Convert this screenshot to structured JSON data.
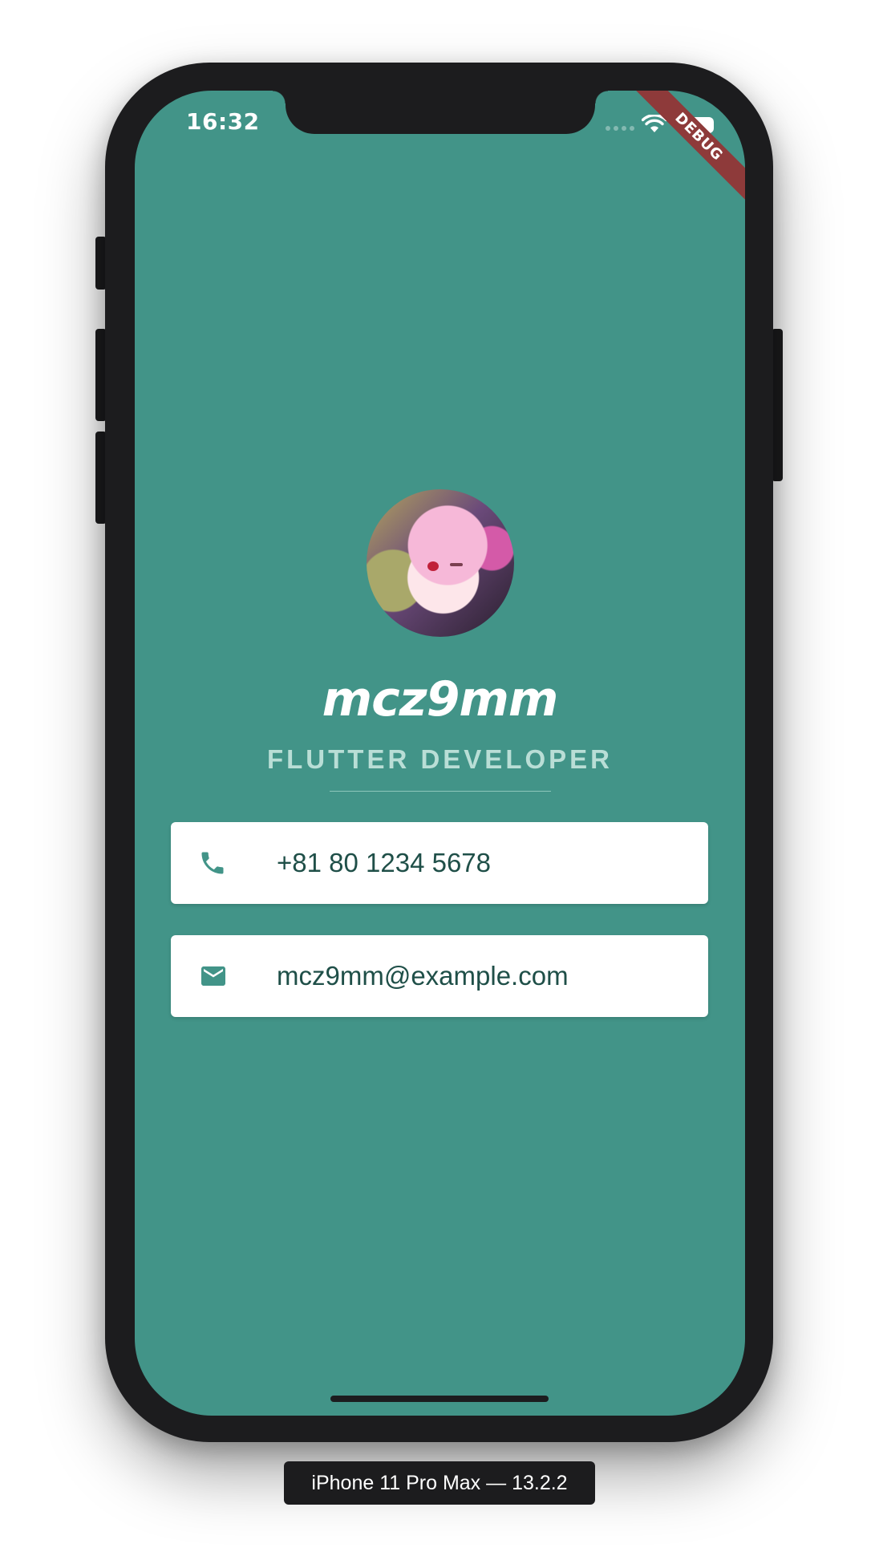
{
  "status_bar": {
    "time": "16:32",
    "debug_label": "DEBUG"
  },
  "profile": {
    "name": "mcz9mm",
    "role": "FLUTTER DEVELOPER"
  },
  "contacts": {
    "phone": "+81 80 1234 5678",
    "email": "mcz9mm@example.com"
  },
  "device_label": "iPhone 11 Pro Max — 13.2.2",
  "colors": {
    "background": "#429488",
    "card": "#ffffff",
    "icon": "#429488",
    "text": "#1f4f48"
  }
}
